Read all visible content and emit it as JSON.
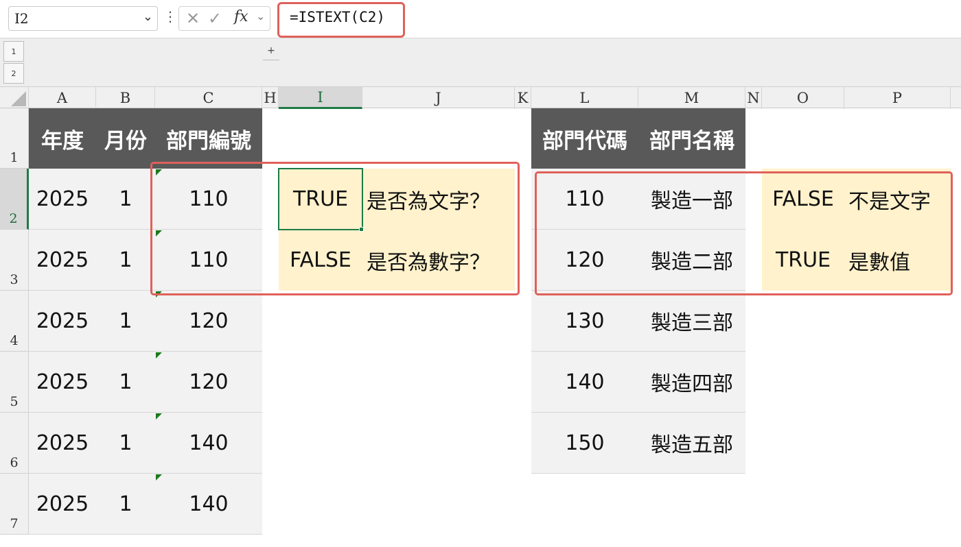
{
  "formula_bar": {
    "name_box": "I2",
    "formula": "=ISTEXT(C2)",
    "cancel_icon": "✕",
    "enter_icon": "✓",
    "fx_label": "fx",
    "chevron": "⌄",
    "more_icon": "⋮"
  },
  "outline": {
    "level1": "1",
    "level2": "2",
    "expand": "+"
  },
  "columns": [
    "A",
    "B",
    "C",
    "H",
    "I",
    "J",
    "K",
    "L",
    "M",
    "N",
    "O",
    "P"
  ],
  "rows": [
    "1",
    "2",
    "3",
    "4",
    "5",
    "6",
    "7"
  ],
  "left_table": {
    "headers": [
      "年度",
      "月份",
      "部門編號"
    ],
    "rows": [
      [
        "2025",
        "1",
        "110"
      ],
      [
        "2025",
        "1",
        "110"
      ],
      [
        "2025",
        "1",
        "120"
      ],
      [
        "2025",
        "1",
        "120"
      ],
      [
        "2025",
        "1",
        "140"
      ],
      [
        "2025",
        "1",
        "140"
      ]
    ]
  },
  "check_results": [
    {
      "value": "TRUE",
      "label": "是否為文字？"
    },
    {
      "value": "FALSE",
      "label": "是否為數字？"
    }
  ],
  "right_table": {
    "headers": [
      "部門代碼",
      "部門名稱"
    ],
    "rows": [
      [
        "110",
        "製造一部"
      ],
      [
        "120",
        "製造二部"
      ],
      [
        "130",
        "製造三部"
      ],
      [
        "140",
        "製造四部"
      ],
      [
        "150",
        "製造五部"
      ]
    ]
  },
  "right_results": [
    {
      "value": "FALSE",
      "label": "不是文字"
    },
    {
      "value": "TRUE",
      "label": "是數值"
    }
  ],
  "colors": {
    "header_fill": "#595959",
    "highlight_fill": "#fff2cc",
    "annotation_red": "#e0605a",
    "selection_green": "#1e7a45"
  }
}
